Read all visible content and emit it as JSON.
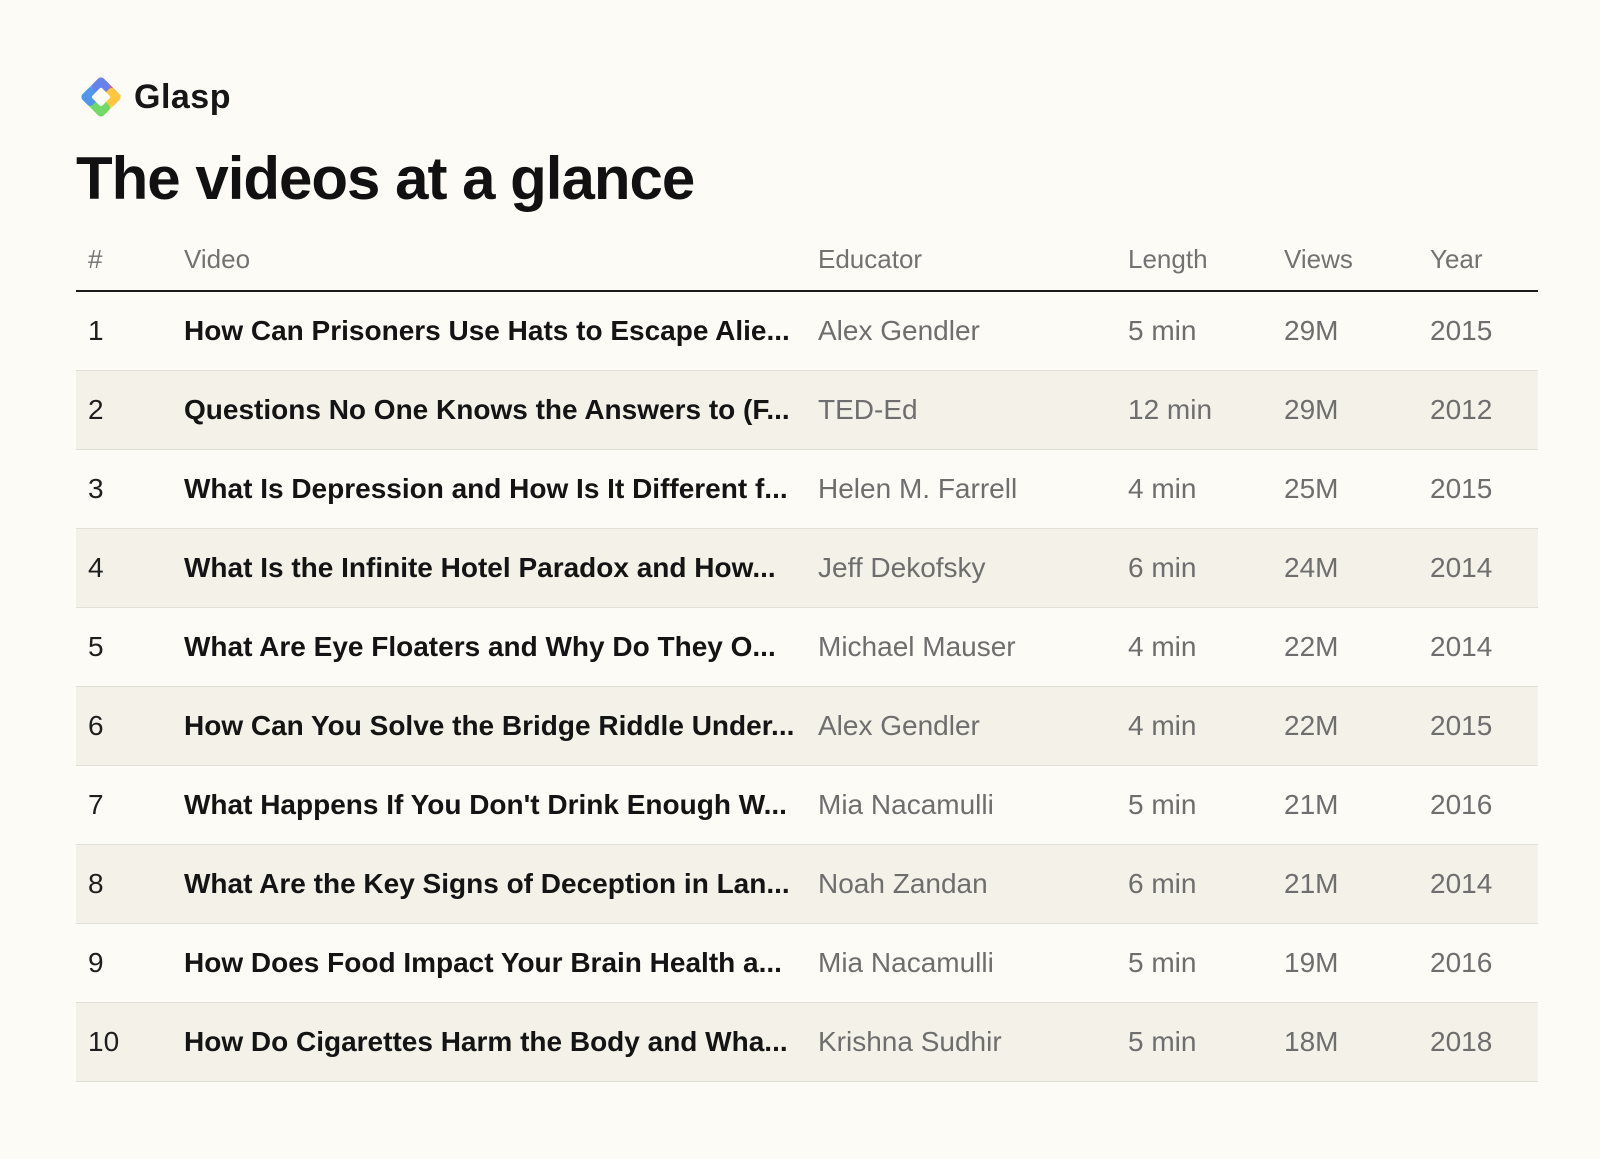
{
  "brand": {
    "name": "Glasp",
    "logo_icon": "glasp-diamond-logo-icon",
    "logo_colors": [
      "#ff4f7b",
      "#ffce3a",
      "#5fdc6a",
      "#4b8bff"
    ]
  },
  "title": "The videos at a glance",
  "table": {
    "headers": {
      "rank": "#",
      "video": "Video",
      "educator": "Educator",
      "length": "Length",
      "views": "Views",
      "year": "Year"
    },
    "rows": [
      {
        "rank": "1",
        "video": "How Can Prisoners Use Hats to Escape Alie...",
        "educator": "Alex Gendler",
        "length": "5 min",
        "views": "29M",
        "year": "2015"
      },
      {
        "rank": "2",
        "video": "Questions No One Knows the Answers to (F...",
        "educator": "TED-Ed",
        "length": "12 min",
        "views": "29M",
        "year": "2012"
      },
      {
        "rank": "3",
        "video": "What Is Depression and How Is It Different f...",
        "educator": "Helen M. Farrell",
        "length": "4 min",
        "views": "25M",
        "year": "2015"
      },
      {
        "rank": "4",
        "video": "What Is the Infinite Hotel Paradox and How...",
        "educator": "Jeff Dekofsky",
        "length": "6 min",
        "views": "24M",
        "year": "2014"
      },
      {
        "rank": "5",
        "video": "What Are Eye Floaters and Why Do They O...",
        "educator": "Michael Mauser",
        "length": "4 min",
        "views": "22M",
        "year": "2014"
      },
      {
        "rank": "6",
        "video": "How Can You Solve the Bridge Riddle Under...",
        "educator": "Alex Gendler",
        "length": "4 min",
        "views": "22M",
        "year": "2015"
      },
      {
        "rank": "7",
        "video": "What Happens If You Don't Drink Enough W...",
        "educator": "Mia Nacamulli",
        "length": "5 min",
        "views": "21M",
        "year": "2016"
      },
      {
        "rank": "8",
        "video": "What Are the Key Signs of Deception in Lan...",
        "educator": "Noah Zandan",
        "length": "6 min",
        "views": "21M",
        "year": "2014"
      },
      {
        "rank": "9",
        "video": "How Does Food Impact Your Brain Health a...",
        "educator": "Mia Nacamulli",
        "length": "5 min",
        "views": "19M",
        "year": "2016"
      },
      {
        "rank": "10",
        "video": "How Do Cigarettes Harm the Body and Wha...",
        "educator": "Krishna Sudhir",
        "length": "5 min",
        "views": "18M",
        "year": "2018"
      }
    ]
  }
}
